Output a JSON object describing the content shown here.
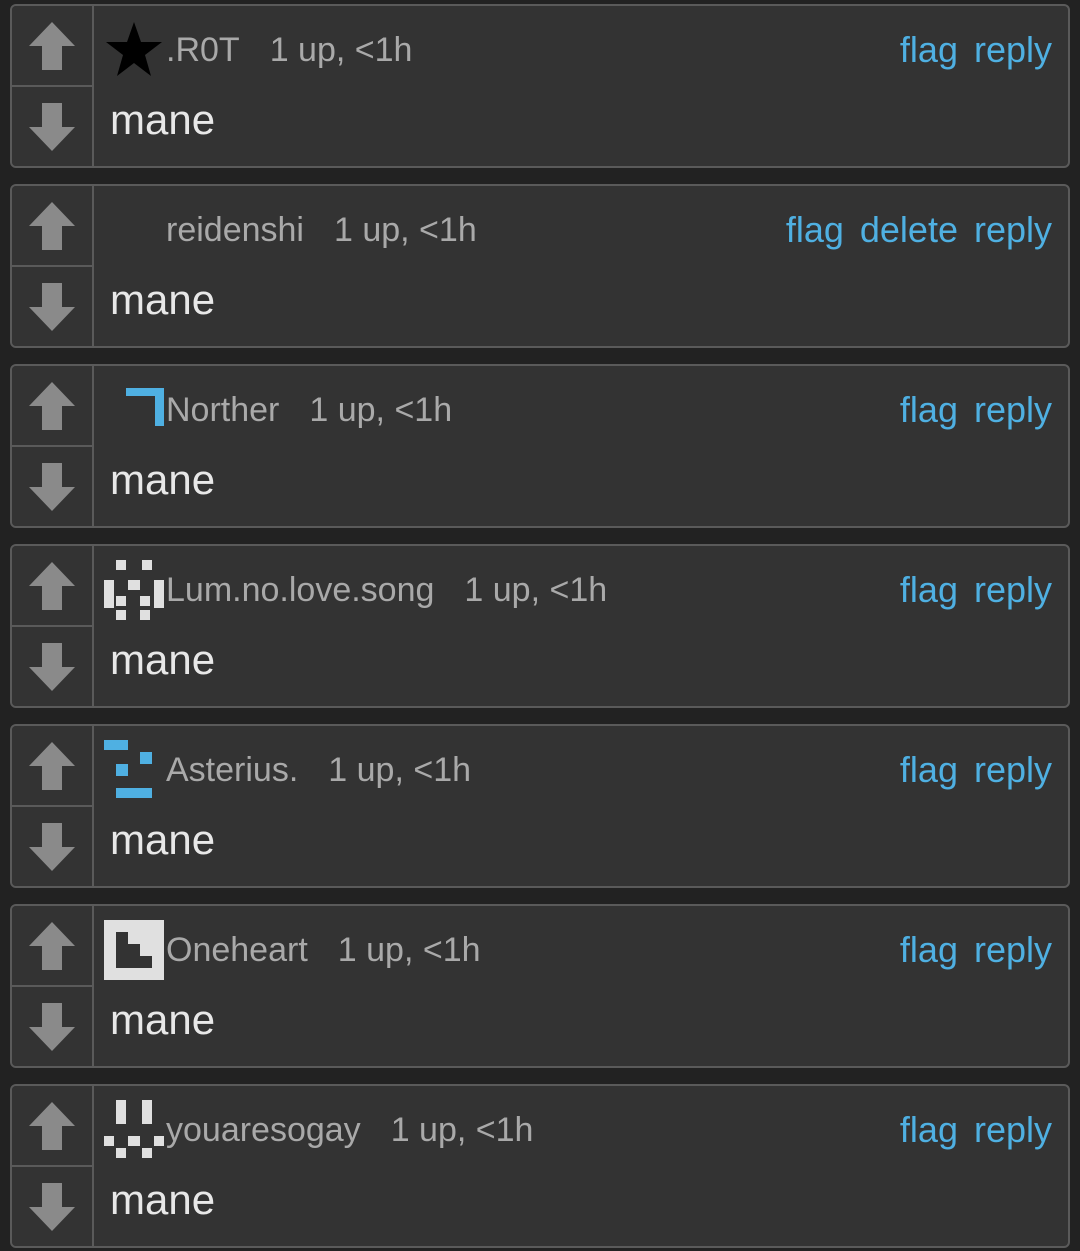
{
  "colors": {
    "background": "#222222",
    "card": "#333333",
    "border": "#5a5a5a",
    "meta_text": "#a9a9a9",
    "body_text": "#e8e8e8",
    "link": "#4fb0e2",
    "arrow": "#8a8a8a"
  },
  "icons": {
    "upvote": "arrow-up-icon",
    "downvote": "arrow-down-icon"
  },
  "comments": [
    {
      "username": ".R0T",
      "score": "1 up, <1h",
      "text": "mane",
      "avatar": "black-star-avatar",
      "actions": {
        "flag": "flag",
        "reply": "reply"
      }
    },
    {
      "username": "reidenshi",
      "score": "1 up, <1h",
      "text": "mane",
      "avatar": "empty-avatar",
      "actions": {
        "flag": "flag",
        "delete": "delete",
        "reply": "reply"
      }
    },
    {
      "username": "Norther",
      "score": "1 up, <1h",
      "text": "mane",
      "avatar": "blue-corner-avatar",
      "actions": {
        "flag": "flag",
        "reply": "reply"
      }
    },
    {
      "username": "Lum.no.love.song",
      "score": "1 up, <1h",
      "text": "mane",
      "avatar": "white-pixel-face-avatar",
      "actions": {
        "flag": "flag",
        "reply": "reply"
      }
    },
    {
      "username": "Asterius.",
      "score": "1 up, <1h",
      "text": "mane",
      "avatar": "blue-pixel-face-avatar",
      "actions": {
        "flag": "flag",
        "reply": "reply"
      }
    },
    {
      "username": "Oneheart",
      "score": "1 up, <1h",
      "text": "mane",
      "avatar": "white-square-pattern-avatar",
      "actions": {
        "flag": "flag",
        "reply": "reply"
      }
    },
    {
      "username": "youaresogay",
      "score": "1 up, <1h",
      "text": "mane",
      "avatar": "white-pixel-smile-avatar",
      "actions": {
        "flag": "flag",
        "reply": "reply"
      }
    }
  ]
}
